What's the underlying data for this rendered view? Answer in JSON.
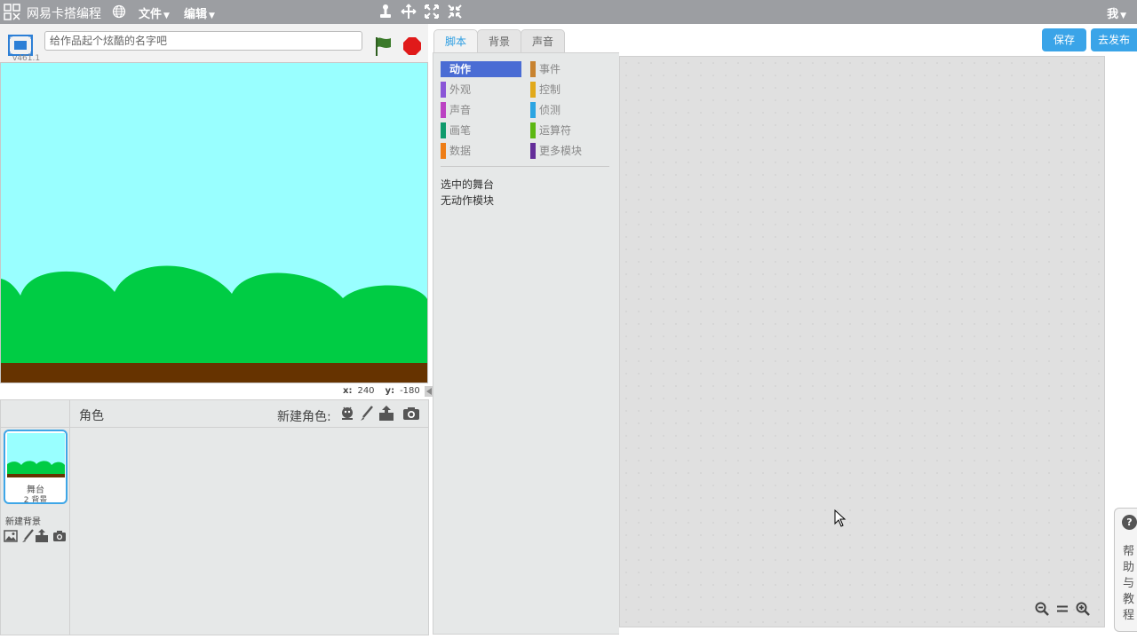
{
  "topbar": {
    "brand": "网易卡搭编程",
    "menus": [
      {
        "label": "文件"
      },
      {
        "label": "编辑"
      }
    ],
    "tools": [
      "duplicate-stamp-icon",
      "cut-scissors-icon",
      "grow-icon",
      "shrink-icon"
    ],
    "user": "我"
  },
  "stage_header": {
    "version": "v461.1",
    "title_placeholder": "给作品起个炫酷的名字吧"
  },
  "stage": {
    "sky_color": "#99ffff",
    "hills_color": "#00cc44",
    "ground_color": "#663300"
  },
  "coords": {
    "x_label": "x:",
    "x_value": "240",
    "y_label": "y:",
    "y_value": "-180"
  },
  "sprites": {
    "label": "角色",
    "new_sprite_label": "新建角色:",
    "new_sprite_icons": [
      "sprite-library-icon",
      "paint-brush-icon",
      "upload-icon",
      "camera-icon"
    ],
    "stage_thumb": {
      "name": "舞台",
      "count": "2 背景"
    },
    "new_backdrop_label": "新建背景",
    "new_backdrop_icons": [
      "backdrop-library-icon",
      "paint-brush-icon",
      "upload-icon",
      "camera-icon"
    ]
  },
  "tabs": [
    {
      "label": "脚本",
      "active": true
    },
    {
      "label": "背景",
      "active": false
    },
    {
      "label": "声音",
      "active": false
    }
  ],
  "actions": {
    "save": "保存",
    "publish": "去发布"
  },
  "palette": {
    "categories": [
      {
        "label": "动作",
        "color": "#4a6cd4",
        "selected": true
      },
      {
        "label": "事件",
        "color": "#c88330"
      },
      {
        "label": "外观",
        "color": "#8a55d7"
      },
      {
        "label": "控制",
        "color": "#e1a91a"
      },
      {
        "label": "声音",
        "color": "#bb42c3"
      },
      {
        "label": "侦测",
        "color": "#2ca5e2"
      },
      {
        "label": "画笔",
        "color": "#0e9a6c"
      },
      {
        "label": "运算符",
        "color": "#5cb712"
      },
      {
        "label": "数据",
        "color": "#ee7d16"
      },
      {
        "label": "更多模块",
        "color": "#632d99"
      }
    ],
    "message_line1": "选中的舞台",
    "message_line2": "无动作模块"
  },
  "zoom": [
    "zoom-out-icon",
    "zoom-reset-icon",
    "zoom-in-icon"
  ],
  "help": {
    "q": "?",
    "text": "帮助与教程"
  }
}
